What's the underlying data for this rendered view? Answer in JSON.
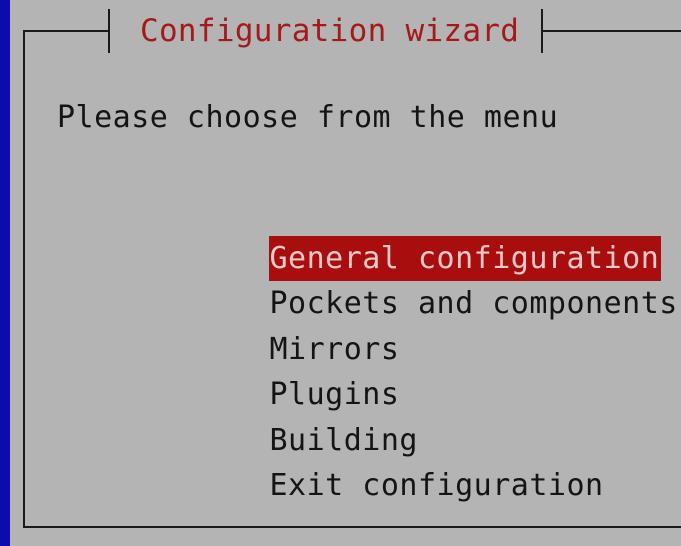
{
  "dialog": {
    "title": "Configuration wizard",
    "prompt": "Please choose from the menu"
  },
  "menu": {
    "selected_index": 0,
    "items": [
      {
        "label": "General configuration"
      },
      {
        "label": "Pockets and components"
      },
      {
        "label": "Mirrors"
      },
      {
        "label": "Plugins"
      },
      {
        "label": "Building"
      },
      {
        "label": "Exit configuration"
      }
    ]
  },
  "colors": {
    "screen_background": "#0c0cae",
    "dialog_background": "#b4b4b4",
    "title_text": "#a41a1a",
    "selection_background": "#a80e0e",
    "selection_text": "#f0c8c8"
  }
}
